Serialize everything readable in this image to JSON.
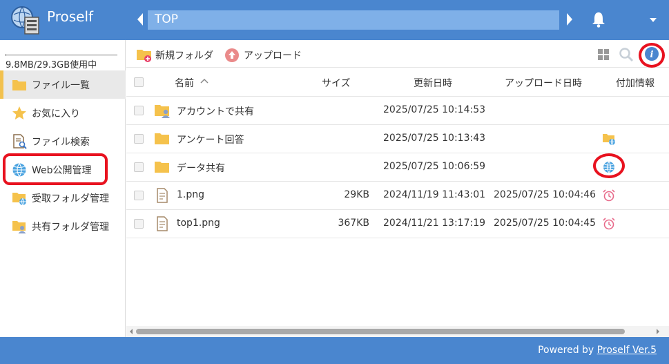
{
  "app": {
    "title": "Proself"
  },
  "header": {
    "path": "TOP"
  },
  "sidebar": {
    "quota_text": "9.8MB/29.3GB使用中",
    "quota_fraction": 0.003,
    "items": [
      {
        "label": "ファイル一覧",
        "icon": "folder-icon",
        "active": true
      },
      {
        "label": "お気に入り",
        "icon": "star-icon"
      },
      {
        "label": "ファイル検索",
        "icon": "file-search-icon"
      },
      {
        "label": "Web公開管理",
        "icon": "globe-icon"
      },
      {
        "label": "受取フォルダ管理",
        "icon": "receive-folder-icon"
      },
      {
        "label": "共有フォルダ管理",
        "icon": "shared-folder-icon"
      }
    ]
  },
  "toolbar": {
    "new_folder_label": "新規フォルダ",
    "upload_label": "アップロード"
  },
  "table": {
    "columns": {
      "name": "名前",
      "size": "サイズ",
      "modified": "更新日時",
      "uploaded": "アップロード日時",
      "extra": "付加情報"
    },
    "rows": [
      {
        "name": "アカウントで共有",
        "type": "shared-folder",
        "size": "",
        "modified": "2025/07/25 10:14:53",
        "uploaded": "",
        "extra_icon": ""
      },
      {
        "name": "アンケート回答",
        "type": "folder",
        "size": "",
        "modified": "2025/07/25 10:13:43",
        "uploaded": "",
        "extra_icon": "receive-folder-icon"
      },
      {
        "name": "データ共有",
        "type": "folder",
        "size": "",
        "modified": "2025/07/25 10:06:59",
        "uploaded": "",
        "extra_icon": "globe-icon"
      },
      {
        "name": "1.png",
        "type": "file",
        "size": "29KB",
        "modified": "2024/11/19 11:43:01",
        "uploaded": "2025/07/25 10:04:46",
        "extra_icon": "alarm-clock-icon"
      },
      {
        "name": "top1.png",
        "type": "file",
        "size": "367KB",
        "modified": "2024/11/21 13:17:19",
        "uploaded": "2025/07/25 10:04:45",
        "extra_icon": "alarm-clock-icon"
      }
    ]
  },
  "footer": {
    "powered_by": "Powered by ",
    "product_link": "Proself Ver.5"
  },
  "colors": {
    "header_bg": "#4a86cf",
    "path_bg": "#7fb0e8",
    "folder": "#f5c24c",
    "highlight": "#e8121f",
    "alarm": "#e86a8a"
  }
}
